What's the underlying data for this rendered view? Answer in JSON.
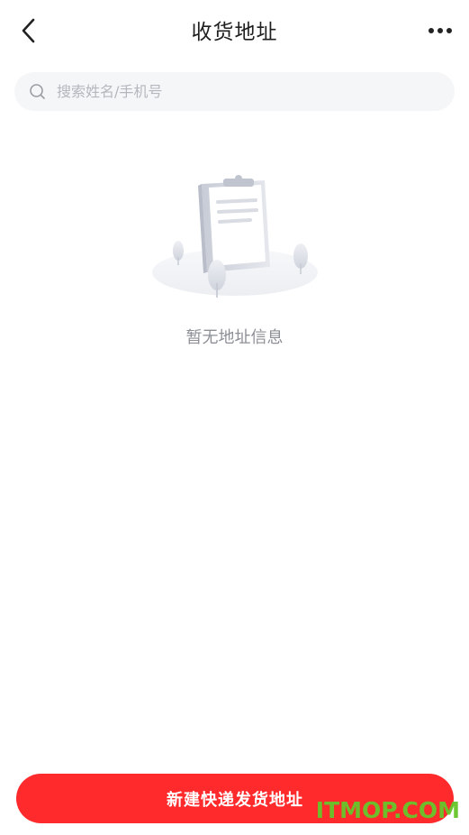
{
  "header": {
    "title": "收货地址",
    "back_icon": "chevron-left-icon",
    "more_icon": "more-horizontal-icon"
  },
  "search": {
    "placeholder": "搜索姓名/手机号",
    "value": "",
    "icon": "search-icon"
  },
  "empty_state": {
    "illustration_icon": "clipboard-empty-illustration",
    "message": "暂无地址信息"
  },
  "footer": {
    "create_button_label": "新建快递发货地址"
  },
  "watermark": {
    "text": "ITMOP.COM"
  },
  "colors": {
    "accent": "#fe2a2c",
    "search_bg": "#f5f6f8",
    "muted_text": "#8c9096",
    "watermark": "#66c62a"
  }
}
